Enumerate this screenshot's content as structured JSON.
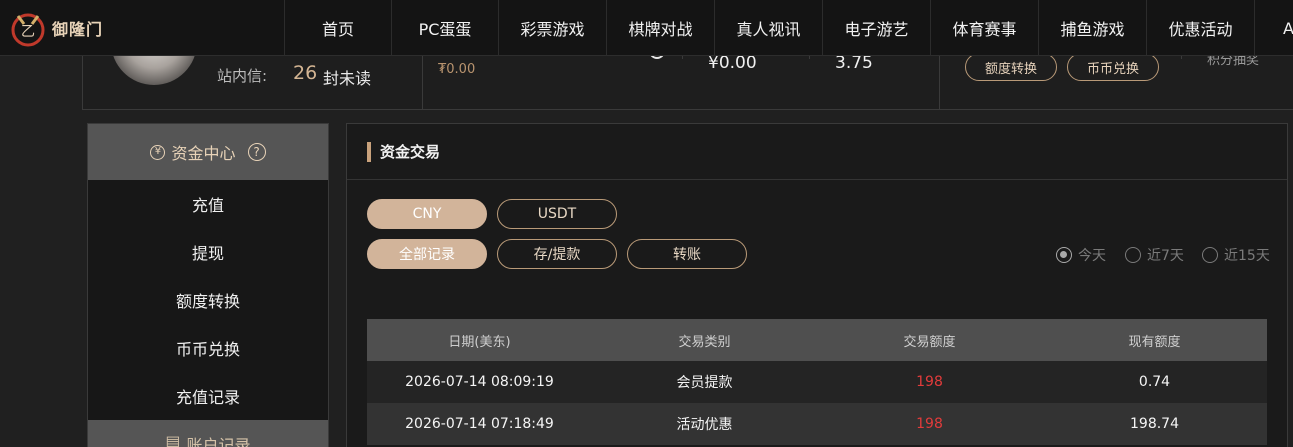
{
  "brand": {
    "logo_text": "御隆门",
    "accent": "#d2b49a",
    "red": "#e23b3b"
  },
  "nav": {
    "items": [
      "首页",
      "PC蛋蛋",
      "彩票游戏",
      "棋牌对战",
      "真人视讯",
      "电子游艺",
      "体育赛事",
      "捕鱼游戏",
      "优惠活动",
      "AP"
    ]
  },
  "account": {
    "mail_label": "站内信:",
    "mail_count": "26",
    "mail_unread": "封未读",
    "balance_small": "₮0.00",
    "balance_main": "¥0.00",
    "rate": "3.75",
    "btn_quota": "额度转换",
    "btn_coin": "币币兑换",
    "points_text": "积分抽奖"
  },
  "sidebar": {
    "header": "资金中心",
    "help": "?",
    "items": [
      "充值",
      "提现",
      "额度转换",
      "币币兑换",
      "充值记录"
    ],
    "header2": "账户记录"
  },
  "main": {
    "title": "资金交易",
    "currency_tabs": [
      "CNY",
      "USDT"
    ],
    "record_tabs": [
      "全部记录",
      "存/提款",
      "转账"
    ],
    "ranges": [
      "今天",
      "近7天",
      "近15天"
    ],
    "table": {
      "headers": [
        "日期(美东)",
        "交易类别",
        "交易额度",
        "现有额度"
      ],
      "rows": [
        [
          "2026-07-14 08:09:19",
          "会员提款",
          "198",
          "0.74"
        ],
        [
          "2026-07-14 07:18:49",
          "活动优惠",
          "198",
          "198.74"
        ]
      ]
    }
  }
}
